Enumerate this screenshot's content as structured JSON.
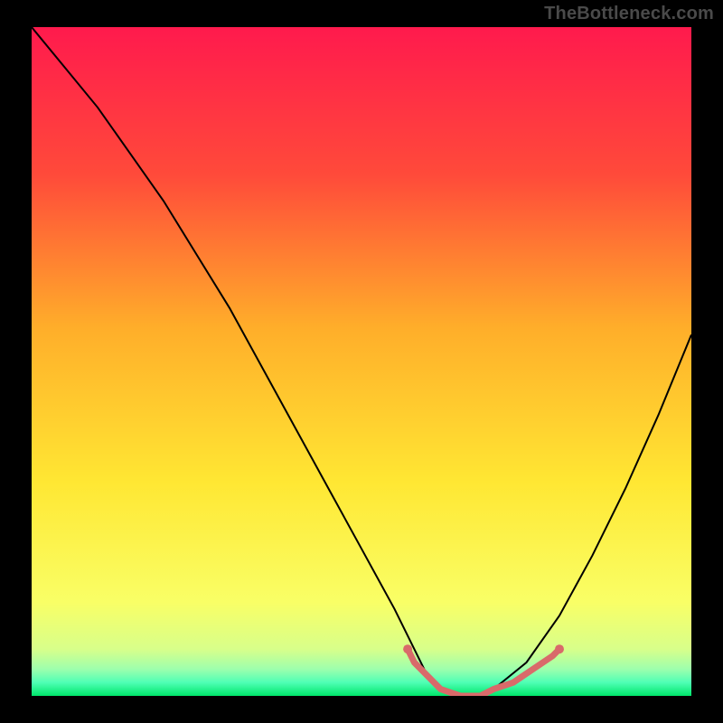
{
  "watermark": "TheBottleneck.com",
  "chart_data": {
    "type": "line",
    "title": "",
    "xlabel": "",
    "ylabel": "",
    "xlim": [
      0,
      100
    ],
    "ylim": [
      0,
      100
    ],
    "grid": false,
    "background": {
      "type": "vertical-gradient",
      "stops": [
        {
          "offset": 0,
          "color": "#ff1a4d"
        },
        {
          "offset": 22,
          "color": "#ff4a3a"
        },
        {
          "offset": 45,
          "color": "#ffae2a"
        },
        {
          "offset": 68,
          "color": "#ffe733"
        },
        {
          "offset": 86,
          "color": "#f9ff66"
        },
        {
          "offset": 93,
          "color": "#d8ff8a"
        },
        {
          "offset": 96,
          "color": "#9dffad"
        },
        {
          "offset": 98,
          "color": "#4fffb5"
        },
        {
          "offset": 100,
          "color": "#00e66b"
        }
      ]
    },
    "series": [
      {
        "name": "bottleneck-curve",
        "color": "#000000",
        "width": 2,
        "x": [
          0,
          5,
          10,
          15,
          20,
          25,
          30,
          35,
          40,
          45,
          50,
          55,
          58,
          60,
          62,
          65,
          68,
          70,
          75,
          80,
          85,
          90,
          95,
          100
        ],
        "y": [
          100,
          94,
          88,
          81,
          74,
          66,
          58,
          49,
          40,
          31,
          22,
          13,
          7,
          3,
          1,
          0,
          0,
          1,
          5,
          12,
          21,
          31,
          42,
          54
        ]
      }
    ],
    "markers": [
      {
        "name": "min-band-left-dot",
        "x": 57,
        "y": 7,
        "r": 5,
        "color": "#d96a6a"
      },
      {
        "name": "min-band-right-dot",
        "x": 80,
        "y": 7,
        "r": 5,
        "color": "#d96a6a"
      }
    ],
    "accent_band": {
      "name": "min-band",
      "color": "#d96a6a",
      "width": 7,
      "x": [
        57,
        58,
        60,
        62,
        65,
        68,
        70,
        73,
        76,
        79,
        80
      ],
      "y": [
        7,
        5,
        3,
        1,
        0,
        0,
        1,
        2,
        4,
        6,
        7
      ]
    }
  }
}
